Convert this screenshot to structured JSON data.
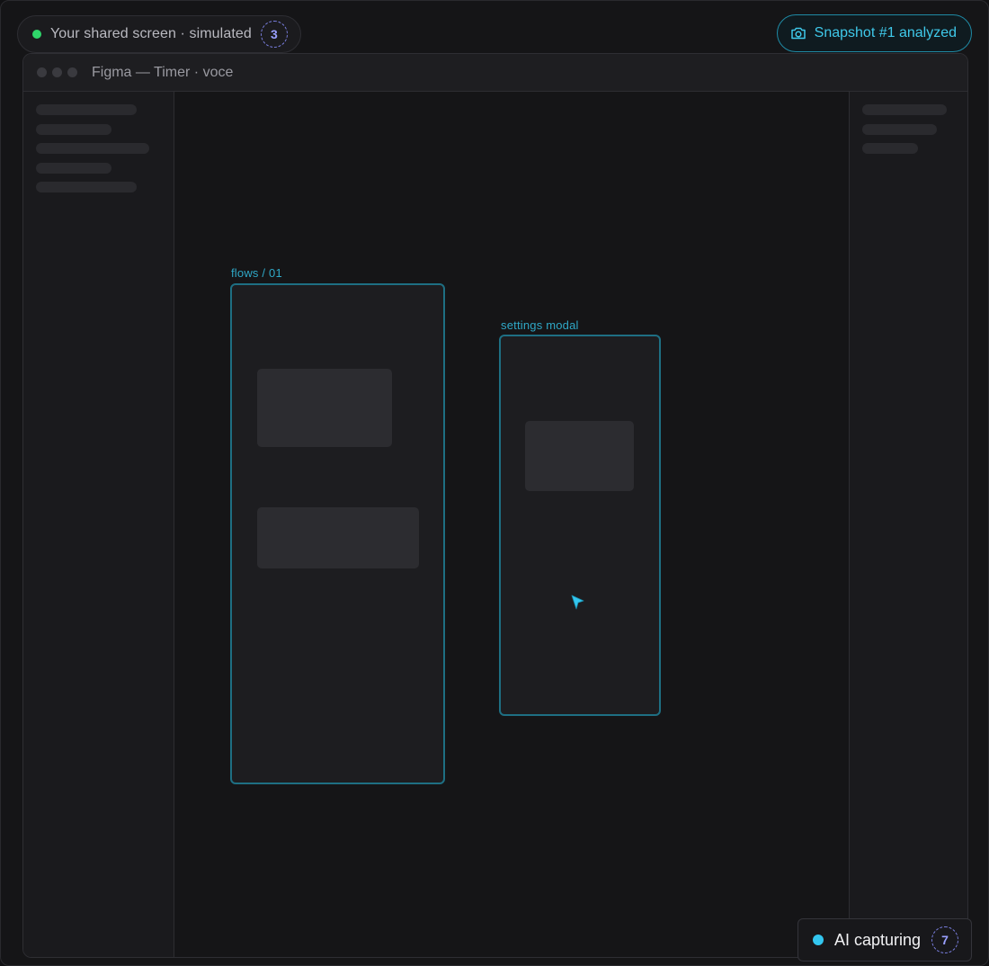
{
  "share": {
    "label": "Your shared screen · simulated",
    "count": "3",
    "status_color": "#2fd66a"
  },
  "snapshot": {
    "label": "Snapshot #1 analyzed",
    "icon": "camera-icon"
  },
  "window": {
    "title": "Figma — Timer · voce"
  },
  "canvas": {
    "frames": [
      {
        "label": "flows / 01"
      },
      {
        "label": "settings modal"
      }
    ]
  },
  "ai": {
    "label": "AI capturing",
    "count": "7",
    "status_color": "#33c6ef"
  },
  "colors": {
    "accent": "#3fc9ea",
    "frame_border": "#1e6f83",
    "badge": "#9aa0ff"
  }
}
